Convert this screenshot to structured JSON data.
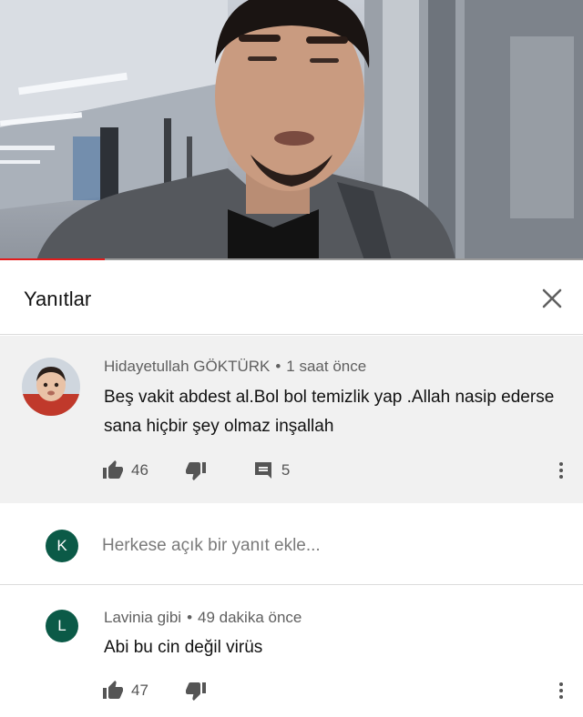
{
  "video": {
    "progress_fraction": 0.18,
    "progress_color": "#e31b1b"
  },
  "panel": {
    "title": "Yanıtlar",
    "close_icon": "close-icon"
  },
  "main_comment": {
    "author": "Hidayetullah GÖKTÜRK",
    "separator": "•",
    "time": "1 saat önce",
    "text": "Beş vakit abdest al.Bol bol temizlik yap .Allah nasip ederse sana hiçbir şey olmaz inşallah",
    "likes": "46",
    "replies": "5"
  },
  "reply_box": {
    "avatar_letter": "K",
    "avatar_color": "#0b5a47",
    "placeholder": "Herkese açık bir yanıt ekle..."
  },
  "reply_comment": {
    "avatar_letter": "L",
    "author": "Lavinia gibi",
    "separator": "•",
    "time": "49 dakika önce",
    "text": "Abi bu cin değil virüs",
    "likes": "47"
  }
}
